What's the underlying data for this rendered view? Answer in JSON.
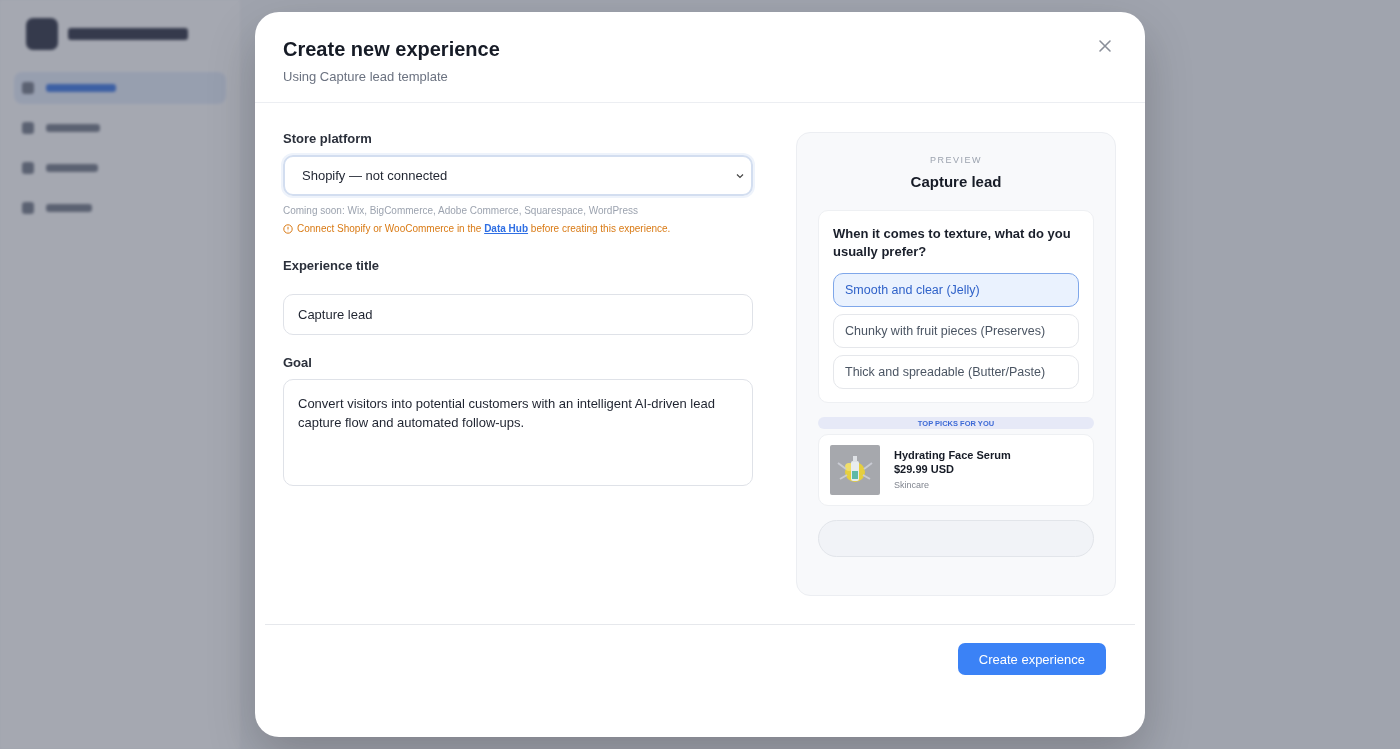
{
  "dialog": {
    "title": "Create new experience",
    "subtitle": "Using Capture lead template",
    "store_platform": {
      "label": "Store platform",
      "value": "Shopify — not connected",
      "hint": "Coming soon: Wix, BigCommerce, Adobe Commerce, Squarespace, WordPress",
      "warning_before": "Connect Shopify or WooCommerce in the",
      "warning_link": "Data Hub",
      "warning_after": "before creating this experience."
    },
    "experience_title": {
      "label": "Experience title",
      "value": "Capture lead"
    },
    "goal": {
      "label": "Goal",
      "value": "Convert visitors into potential customers with an intelligent AI-driven lead capture flow and automated follow-ups."
    },
    "preview": {
      "eyebrow": "PREVIEW",
      "title": "Capture lead",
      "question": "When it comes to texture, what do you usually prefer?",
      "options": [
        {
          "label": "Smooth and clear (Jelly)",
          "selected": true
        },
        {
          "label": "Chunky with fruit pieces (Preserves)",
          "selected": false
        },
        {
          "label": "Thick and spreadable (Butter/Paste)",
          "selected": false
        }
      ],
      "picks_heading": "TOP PICKS FOR YOU",
      "products": [
        {
          "kind": "picture",
          "name": "Hydrating Face Serum",
          "price": "$29.99 USD",
          "category": "Skincare"
        }
      ]
    },
    "create_button": "Create experience"
  }
}
